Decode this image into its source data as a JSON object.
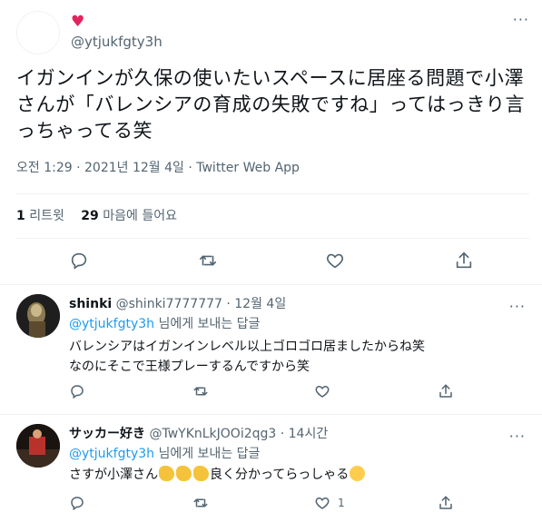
{
  "tweet": {
    "display_name": "♥",
    "handle": "@ytjukfgty3h",
    "text": "イガンインが久保の使いたいスペースに居座る問題で小澤さんが「バレンシアの育成の失敗ですね」ってはっきり言っちゃってる笑",
    "meta": "오전 1:29 · 2021년 12월 4일 · Twitter Web App",
    "retweets_count": "1",
    "retweets_label": "리트윗",
    "likes_count": "29",
    "likes_label": "마음에 들어요",
    "more": "···"
  },
  "replies": [
    {
      "name": "shinki",
      "handle": "@shinki7777777",
      "time": "· 12월 4일",
      "reply_to_link": "@ytjukfgty3h",
      "reply_to_suffix": " 님에게 보내는 답글",
      "line1": "バレンシアはイガンインレベル以上ゴロゴロ居ましたからね笑",
      "line2": "なのにそこで王様プレーするんですから笑",
      "like_count": "",
      "more": "···"
    },
    {
      "name": "サッカー好き",
      "handle": "@TwYKnLkJOOi2qg3",
      "time": "· 14시간",
      "reply_to_link": "@ytjukfgty3h",
      "reply_to_suffix": " 님에게 보내는 답글",
      "text_a": "さすが小澤さん",
      "text_b": "良く分かってらっしゃる",
      "like_count": "1",
      "more": "···"
    }
  ],
  "icons": [
    "reply-icon",
    "retweet-icon",
    "like-icon",
    "share-icon",
    "clapping-hands-icon",
    "grinning-face-icon"
  ],
  "colors": {
    "link": "#1d9bf0",
    "secondary": "#536471",
    "heart": "#e0245e",
    "divider": "#eff3f4"
  }
}
